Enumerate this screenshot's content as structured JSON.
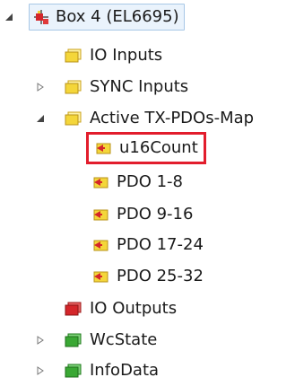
{
  "tree": {
    "root": {
      "label": "Box 4 (EL6695)",
      "expanded": true,
      "icon": "terminal-box-icon"
    },
    "io_inputs": {
      "label": "IO Inputs",
      "icon": "yellow-folder-icon"
    },
    "sync_inputs": {
      "label": "SYNC Inputs",
      "icon": "yellow-folder-icon",
      "expanded": false
    },
    "active_tx_pdos": {
      "label": "Active TX-PDOs-Map",
      "icon": "yellow-folder-icon",
      "expanded": true,
      "children": [
        {
          "label": "u16Count",
          "icon": "pdo-entry-icon",
          "highlighted": true
        },
        {
          "label": "PDO 1-8",
          "icon": "pdo-entry-icon"
        },
        {
          "label": "PDO 9-16",
          "icon": "pdo-entry-icon"
        },
        {
          "label": "PDO 17-24",
          "icon": "pdo-entry-icon"
        },
        {
          "label": "PDO 25-32",
          "icon": "pdo-entry-icon"
        }
      ]
    },
    "io_outputs": {
      "label": "IO Outputs",
      "icon": "red-folder-icon"
    },
    "wcstate": {
      "label": "WcState",
      "icon": "green-folder-icon",
      "expanded": false
    },
    "infodata": {
      "label": "InfoData",
      "icon": "green-folder-icon",
      "expanded": false
    }
  },
  "colors": {
    "highlight_border": "#e21d2c",
    "selection_bg": "#eaf3fc",
    "selection_border": "#a8c7e6",
    "folder_yellow": "#f4d63a",
    "folder_red": "#d4262a",
    "folder_green": "#3aa834"
  }
}
